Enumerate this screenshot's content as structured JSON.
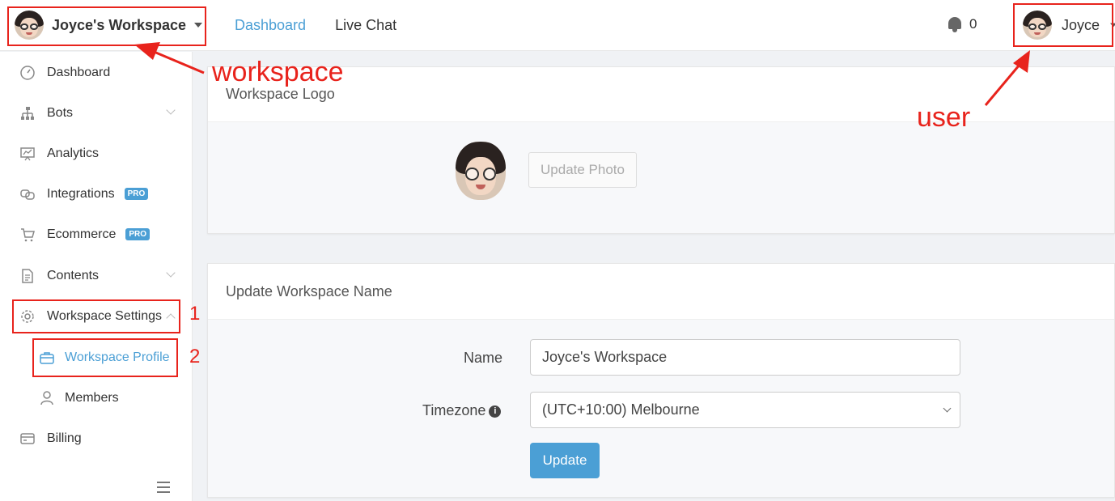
{
  "header": {
    "workspace_name": "Joyce's Workspace",
    "nav": [
      "Dashboard",
      "Live Chat"
    ],
    "active_nav": "Dashboard",
    "notification_count": "0",
    "user_name": "Joyce"
  },
  "sidebar": {
    "items": [
      {
        "label": "Dashboard",
        "icon": "dashboard-gauge-icon"
      },
      {
        "label": "Bots",
        "icon": "sitemap-icon",
        "expandable": true
      },
      {
        "label": "Analytics",
        "icon": "chart-board-icon"
      },
      {
        "label": "Integrations",
        "icon": "link-icon",
        "badge": "PRO"
      },
      {
        "label": "Ecommerce",
        "icon": "cart-icon",
        "badge": "PRO"
      },
      {
        "label": "Contents",
        "icon": "document-icon",
        "expandable": true
      },
      {
        "label": "Workspace Settings",
        "icon": "gear-icon",
        "expanded": true
      },
      {
        "label": "Workspace Profile",
        "icon": "briefcase-icon",
        "sub": true,
        "active": true
      },
      {
        "label": "Members",
        "icon": "person-icon",
        "sub": true
      },
      {
        "label": "Billing",
        "icon": "credit-card-icon"
      }
    ]
  },
  "logo_card": {
    "title": "Workspace Logo",
    "button": "Update Photo"
  },
  "name_card": {
    "title": "Update Workspace Name",
    "name_label": "Name",
    "name_value": "Joyce's Workspace",
    "timezone_label": "Timezone",
    "timezone_value": "(UTC+10:00) Melbourne",
    "submit": "Update"
  },
  "annotations": {
    "workspace": "workspace",
    "user": "user",
    "step1": "1",
    "step2": "2"
  },
  "colors": {
    "accent": "#4b9fd5",
    "annotation": "#e8231c"
  }
}
